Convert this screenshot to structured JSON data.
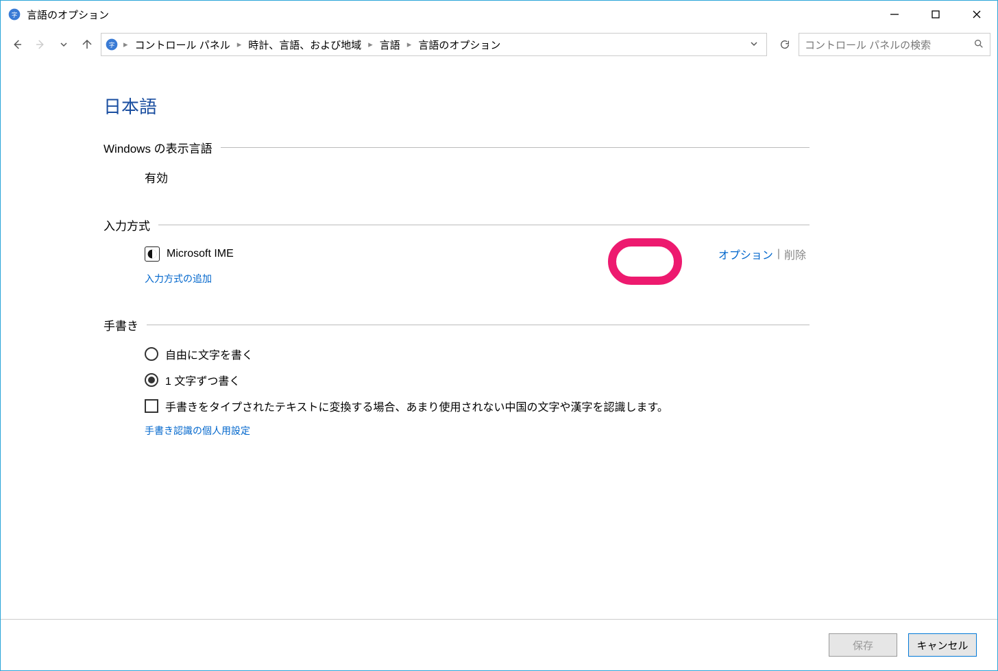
{
  "window": {
    "title": "言語のオプション"
  },
  "breadcrumb": {
    "items": [
      "コントロール パネル",
      "時計、言語、および地域",
      "言語",
      "言語のオプション"
    ]
  },
  "search": {
    "placeholder": "コントロール パネルの検索"
  },
  "page": {
    "title": "日本語"
  },
  "sections": {
    "display_language": {
      "title": "Windows の表示言語",
      "status": "有効"
    },
    "input_method": {
      "title": "入力方式",
      "ime_name": "Microsoft IME",
      "options_link": "オプション",
      "remove_link": "削除",
      "add_link": "入力方式の追加"
    },
    "handwriting": {
      "title": "手書き",
      "option_free": "自由に文字を書く",
      "option_onechar": "1 文字ずつ書く",
      "checkbox_label": "手書きをタイプされたテキストに変換する場合、あまり使用されない中国の文字や漢字を認識します。",
      "personalize_link": "手書き認識の個人用設定"
    }
  },
  "footer": {
    "save": "保存",
    "cancel": "キャンセル"
  }
}
